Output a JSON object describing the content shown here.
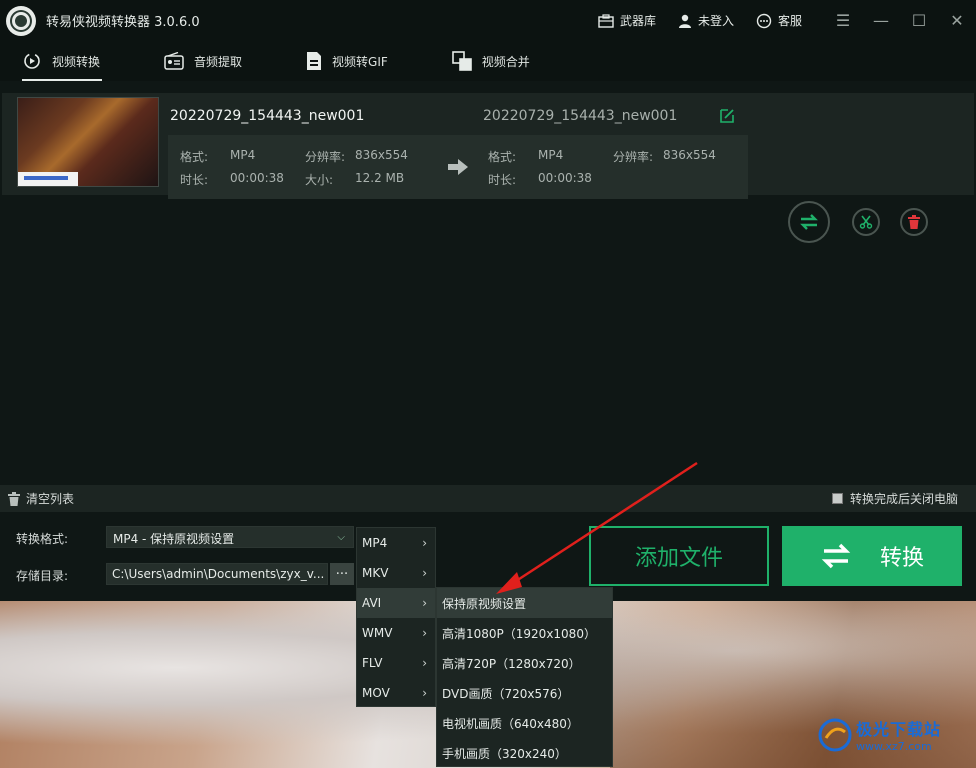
{
  "app": {
    "title": "转易侠视频转换器 3.0.6.0"
  },
  "header": {
    "weapons_label": "武器库",
    "login_label": "未登入",
    "service_label": "客服"
  },
  "tabs": [
    {
      "label": "视频转换",
      "icon": "video-convert-icon",
      "active": true
    },
    {
      "label": "音频提取",
      "icon": "audio-extract-icon",
      "active": false
    },
    {
      "label": "视频转GIF",
      "icon": "gif-icon",
      "active": false
    },
    {
      "label": "视频合并",
      "icon": "merge-icon",
      "active": false
    }
  ],
  "file": {
    "source_name": "20220729_154443_new001",
    "output_name": "20220729_154443_new001",
    "format_label": "格式:",
    "duration_label": "时长:",
    "resolution_label": "分辨率:",
    "size_label": "大小:",
    "source_format": "MP4",
    "source_duration": "00:00:38",
    "source_resolution": "836x554",
    "source_size": "12.2 MB",
    "output_format": "MP4",
    "output_duration": "00:00:38",
    "output_resolution": "836x554"
  },
  "bottom_bar": {
    "clear_list_label": "清空列表",
    "shutdown_label": "转换完成后关闭电脑"
  },
  "settings": {
    "format_label": "转换格式:",
    "format_value": "MP4 - 保持原视频设置",
    "dir_label": "存储目录:",
    "dir_value": "C:\\Users\\admin\\Documents\\zyx_v...",
    "browse_label": "...",
    "add_file_label": "添加文件",
    "convert_label": "转换"
  },
  "format_menu": [
    {
      "label": "MP4",
      "active": false
    },
    {
      "label": "MKV",
      "active": false
    },
    {
      "label": "AVI",
      "active": true
    },
    {
      "label": "WMV",
      "active": false
    },
    {
      "label": "FLV",
      "active": false
    },
    {
      "label": "MOV",
      "active": false
    }
  ],
  "submenu": [
    {
      "label": "保持原视频设置",
      "active": true
    },
    {
      "label": "高清1080P（1920x1080）",
      "active": false
    },
    {
      "label": "高清720P（1280x720）",
      "active": false
    },
    {
      "label": "DVD画质（720x576）",
      "active": false
    },
    {
      "label": "电视机画质（640x480）",
      "active": false
    },
    {
      "label": "手机画质（320x240）",
      "active": false
    }
  ],
  "watermark": {
    "main": "极光下载站",
    "sub": "www.xz7.com"
  },
  "colors": {
    "accent": "#1fb16a",
    "background": "#0f1715",
    "panel": "#1c2522",
    "arrow": "#e0201c"
  }
}
